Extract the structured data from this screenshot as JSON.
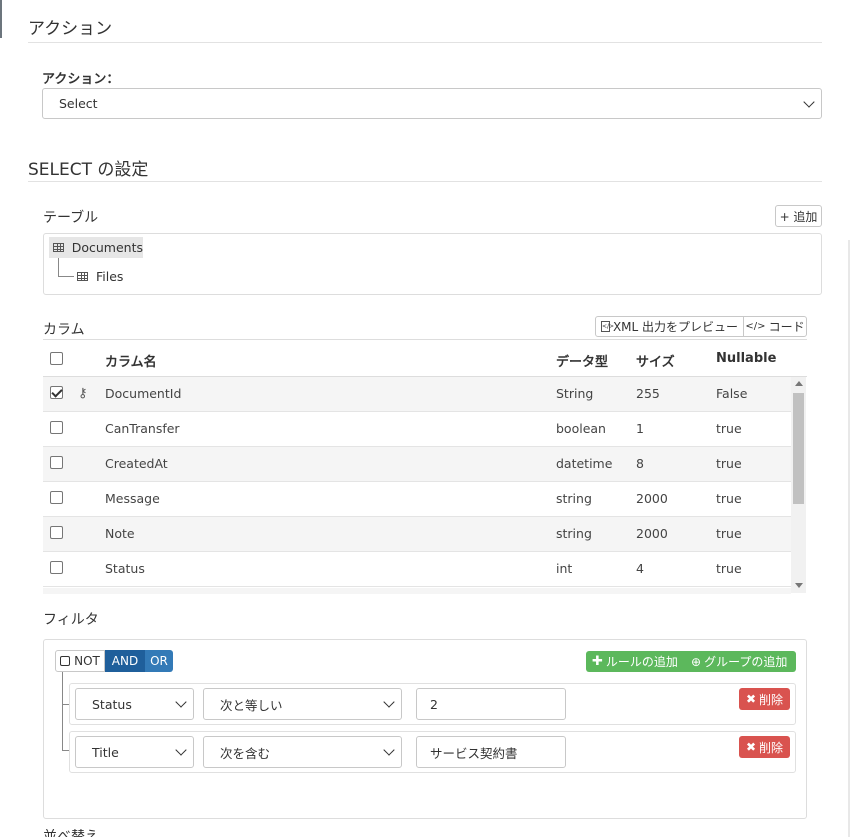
{
  "action_section": {
    "title": "アクション",
    "field_label": "アクション：",
    "selected": "Select"
  },
  "select_settings": {
    "title": "SELECT の設定"
  },
  "tables": {
    "label": "テーブル",
    "add_button": "+ 追加",
    "tree": [
      {
        "name": "Documents",
        "selected": true
      },
      {
        "name": "Files",
        "selected": false
      }
    ]
  },
  "columns": {
    "label": "カラム",
    "preview_button": "XML 出力をプレビュー",
    "code_button": "コード",
    "headers": {
      "name": "カラム名",
      "type": "データ型",
      "size": "サイズ",
      "nullable": "Nullable"
    },
    "rows": [
      {
        "checked": true,
        "key": true,
        "name": "DocumentId",
        "type": "String",
        "size": "255",
        "nullable": "False"
      },
      {
        "checked": false,
        "key": false,
        "name": "CanTransfer",
        "type": "boolean",
        "size": "1",
        "nullable": "true"
      },
      {
        "checked": false,
        "key": false,
        "name": "CreatedAt",
        "type": "datetime",
        "size": "8",
        "nullable": "true"
      },
      {
        "checked": false,
        "key": false,
        "name": "Message",
        "type": "string",
        "size": "2000",
        "nullable": "true"
      },
      {
        "checked": false,
        "key": false,
        "name": "Note",
        "type": "string",
        "size": "2000",
        "nullable": "true"
      },
      {
        "checked": false,
        "key": false,
        "name": "Status",
        "type": "int",
        "size": "4",
        "nullable": "true"
      }
    ]
  },
  "filter": {
    "label": "フィルタ",
    "not_label": "NOT",
    "and_label": "AND",
    "or_label": "OR",
    "add_rule": "ルールの追加",
    "add_group": "グループの追加",
    "rules": [
      {
        "field": "Status",
        "operator": "次と等しい",
        "value": "2",
        "delete": "削除"
      },
      {
        "field": "Title",
        "operator": "次を含む",
        "value": "サービス契約書",
        "delete": "削除"
      }
    ]
  },
  "sort_label_partial": "並べ替え",
  "colors": {
    "and_active": "#1f5f9b",
    "or": "#337ab7",
    "green": "#5cb85c",
    "red": "#d9534f"
  }
}
